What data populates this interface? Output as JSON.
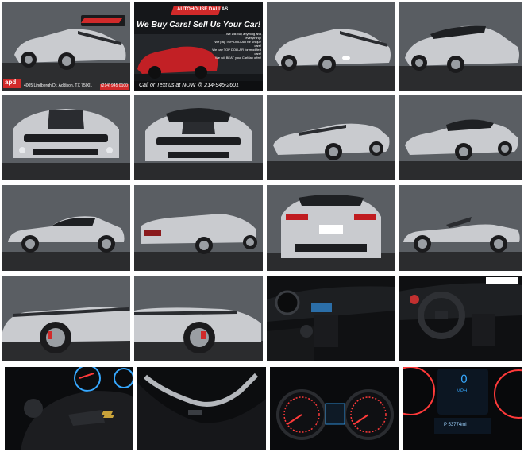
{
  "gallery": {
    "banner": {
      "dealer_logo_text": "AUTOHOUSE DALLAS",
      "headline": "We Buy Cars!  Sell Us Your Car!",
      "lines": [
        "We will buy anything and everything!",
        "We pay TOP DOLLAR for unique cars!",
        "We pay TOP DOLLAR for modified cars!",
        "We will BEAT your CarMax offer!"
      ],
      "footer": "Call or Text us at NOW @ 214-945-2601"
    },
    "first_photo": {
      "address": "4005 Lindbergh Dr. Addison, TX 75001",
      "phone": "(214) 945 0100",
      "badge": "apd"
    },
    "dash": {
      "speed": "0",
      "unit": "MPH",
      "odometer": "P 53774mi"
    }
  },
  "colors": {
    "car_silver": "#c9cbcf",
    "stripe": "#2a2c30",
    "wall": "#5a5e63",
    "floor": "#2b2c2e",
    "accent_red": "#d12a2a",
    "gauge_red": "#ff3a3a",
    "gauge_blue": "#36a8ff"
  }
}
